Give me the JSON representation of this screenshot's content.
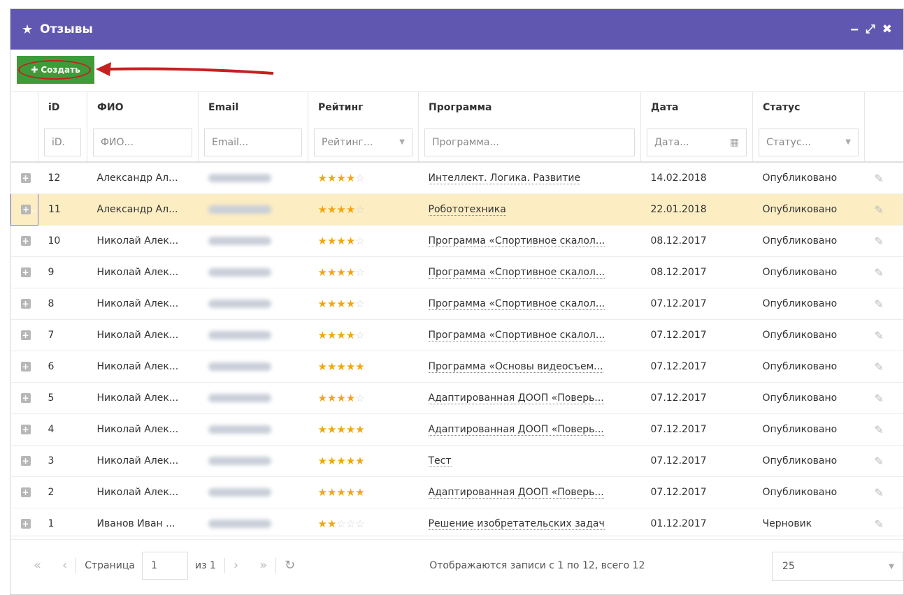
{
  "window": {
    "title": "Отзывы",
    "star_icon": "★",
    "controls": [
      "‒",
      "⤢",
      "✖"
    ]
  },
  "toolbar": {
    "create_label": "Создать",
    "plus": "✚"
  },
  "columns": {
    "id": "iD",
    "fio": "ФИО",
    "email": "Email",
    "rating": "Рейтинг",
    "program": "Программа",
    "date": "Дата",
    "status": "Статус"
  },
  "filters": {
    "id": "iD.",
    "fio": "ФИО...",
    "email": "Email...",
    "rating": "Рейтинг...",
    "program": "Программа...",
    "date": "Дата...",
    "status": "Статус..."
  },
  "rows": [
    {
      "id": "12",
      "fio": "Александр Ал...",
      "stars": 4,
      "program": "Интеллект. Логика. Развитие",
      "date": "14.02.2018",
      "status": "Опубликовано"
    },
    {
      "id": "11",
      "fio": "Александр Ал...",
      "stars": 4,
      "program": "Робототехника",
      "date": "22.01.2018",
      "status": "Опубликовано"
    },
    {
      "id": "10",
      "fio": "Николай Алек...",
      "stars": 4,
      "program": "Программа «Спортивное скалол...",
      "date": "08.12.2017",
      "status": "Опубликовано"
    },
    {
      "id": "9",
      "fio": "Николай Алек...",
      "stars": 4,
      "program": "Программа «Спортивное скалол...",
      "date": "08.12.2017",
      "status": "Опубликовано"
    },
    {
      "id": "8",
      "fio": "Николай Алек...",
      "stars": 4,
      "program": "Программа «Спортивное скалол...",
      "date": "07.12.2017",
      "status": "Опубликовано"
    },
    {
      "id": "7",
      "fio": "Николай Алек...",
      "stars": 4,
      "program": "Программа «Спортивное скалол...",
      "date": "07.12.2017",
      "status": "Опубликовано"
    },
    {
      "id": "6",
      "fio": "Николай Алек...",
      "stars": 5,
      "program": "Программа «Основы видеосъем...",
      "date": "07.12.2017",
      "status": "Опубликовано"
    },
    {
      "id": "5",
      "fio": "Николай Алек...",
      "stars": 4,
      "program": "Адаптированная ДООП «Поверь...",
      "date": "07.12.2017",
      "status": "Опубликовано"
    },
    {
      "id": "4",
      "fio": "Николай Алек...",
      "stars": 5,
      "program": "Адаптированная ДООП «Поверь...",
      "date": "07.12.2017",
      "status": "Опубликовано"
    },
    {
      "id": "3",
      "fio": "Николай Алек...",
      "stars": 5,
      "program": "Тест",
      "date": "07.12.2017",
      "status": "Опубликовано"
    },
    {
      "id": "2",
      "fio": "Николай Алек...",
      "stars": 5,
      "program": "Адаптированная ДООП «Поверь...",
      "date": "07.12.2017",
      "status": "Опубликовано"
    },
    {
      "id": "1",
      "fio": "Иванов Иван ...",
      "stars": 2,
      "program": "Решение изобретательских задач",
      "date": "01.12.2017",
      "status": "Черновик"
    }
  ],
  "selected_row_id": "11",
  "pager": {
    "first": "«",
    "prev": "‹",
    "page_label": "Страница",
    "page_value": "1",
    "of_label": "из 1",
    "next": "›",
    "last": "»",
    "refresh": "↻",
    "summary": "Отображаются записи с 1 по 12, всего 12",
    "page_size": "25"
  },
  "colors": {
    "title_bar": "#6058b0",
    "create_button": "#3f9b3a",
    "selected_row": "#fcedc3",
    "star": "#f0a60f",
    "annotation": "#c62020"
  }
}
